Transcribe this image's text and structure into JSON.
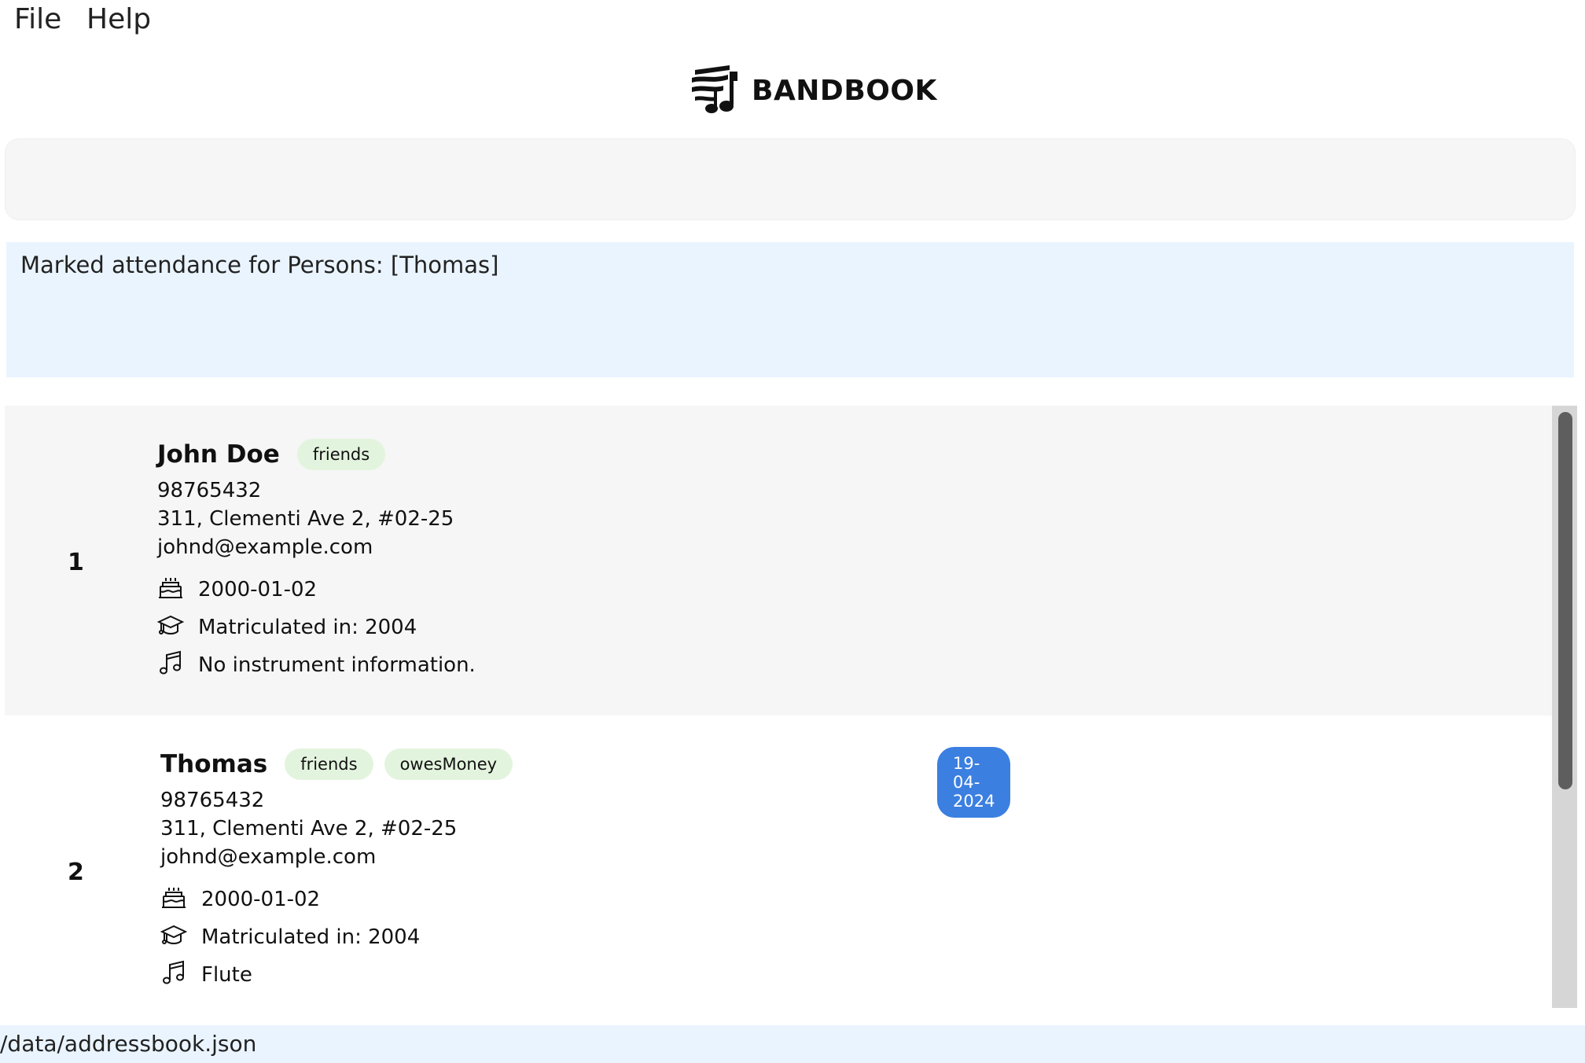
{
  "menu": {
    "file": "File",
    "help": "Help"
  },
  "brand": {
    "name": "BANDBOOK",
    "icon": "music-logo-icon"
  },
  "command": {
    "value": "",
    "placeholder": ""
  },
  "result": {
    "text": "Marked attendance for Persons: [Thomas]"
  },
  "persons": [
    {
      "index": "1",
      "name": "John Doe",
      "tags": [
        "friends"
      ],
      "attendance": "",
      "phone": "98765432",
      "address": "311, Clementi Ave 2, #02-25",
      "email": "johnd@example.com",
      "birthday": "2000-01-02",
      "matriculation": "Matriculated in: 2004",
      "instrument": "No instrument information."
    },
    {
      "index": "2",
      "name": "Thomas",
      "tags": [
        "friends",
        "owesMoney"
      ],
      "attendance": "19-04-2024",
      "phone": "98765432",
      "address": "311, Clementi Ave 2, #02-25",
      "email": "johnd@example.com",
      "birthday": "2000-01-02",
      "matriculation": "Matriculated in: 2004",
      "instrument": "Flute"
    }
  ],
  "colors": {
    "tag_bg": "#e3f4de",
    "date_badge_bg": "#3b7fe0",
    "result_bg": "#eaf4fe",
    "card_alt_bg": "#f6f6f6"
  },
  "status": {
    "path": "/data/addressbook.json"
  }
}
